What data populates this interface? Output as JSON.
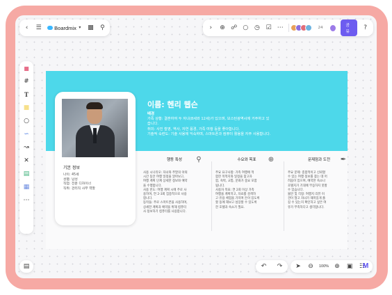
{
  "app": {
    "name": "Boardmix",
    "share_label": "공유",
    "avatar_count": "24",
    "zoom": "100%"
  },
  "toolbar_icons_top_left": [
    "back-icon",
    "menu-icon",
    "cloud-logo-icon",
    "chevron-down-icon",
    "present-icon",
    "search-icon"
  ],
  "toolbar_icons_top_right": [
    "chevron-right-icon",
    "add-icon",
    "ai-icon",
    "comment-icon",
    "timer-icon",
    "vote-icon",
    "more-icon"
  ],
  "sidebar_tools": [
    "sticky-multi-icon",
    "frame-icon",
    "text-icon",
    "sticky-note-icon",
    "shape-icon",
    "pen-icon",
    "connector-icon",
    "mindmap-icon",
    "table-icon",
    "template-icon",
    "more-tools-icon"
  ],
  "profile": {
    "name_title": "이름: 헨리 웹슨",
    "background_label": "배경",
    "background_lines": [
      "가족 상황: 결혼하여 두 자녀(8세와 12세)가 있으며, 보스턴광역시에 거주하고 있",
      "습니다.",
      "취미: 사진 촬영, 역사, 자연 풍경, 가족 여행 등을 좋아합니다.",
      "기술적 숙련도: 기술 사용에 익숙하며, 스마트폰과 컴퓨터 활용을 자주 사용합니다."
    ],
    "basic_title": "기본 정보",
    "basic_items": [
      "나이: 45세",
      "성별: 남성",
      "직업: 전문 디자이너",
      "직위: 관리직 사무 역할"
    ]
  },
  "columns": [
    {
      "title": "행동 특성",
      "icon": "search-person-icon",
      "lines": [
        "사용 시나리오: 자녀와 주말의 야외",
        "시간 동안 여행 일정을 알아보고,",
        "여행 계획 단계 상세한 정보와 예약",
        "을 수행합니다.",
        "사용 빈도: 여행 계획 시에 주로 사",
        "용하며, 연 2-3회 집중적으로 사용",
        "합니다.",
        "동작들: 주로 스마트폰을 사용하며,",
        "상세한 계획과 예약을 위해 컴퓨터",
        "사 정보하기 컴퓨터를 사용합니다."
      ]
    },
    {
      "title": "수요와 목표",
      "icon": "target-icon",
      "lines": [
        "주요 요구사항: 가족 여행에 적",
        "합한 목적지와 일정을 찾고자",
        "함, 숙박, 교통, 문화가 중요 포함",
        "됩니다.",
        "사용자 목표: 연 2회 이상 가족",
        "여행을 계획하고, 자료를 검색하",
        "고 유용 체험을 가지며 돈이 있도록",
        "할 동에 해보고 성장할 수 있도록",
        "한 호텔과 숙소가 필요."
      ]
    },
    {
      "title": "문제점과 도전",
      "icon": "tools-icon",
      "lines": [
        "주요 문제: 종합적이고 신뢰할",
        "수 있는 여행 정보를 찾는 데 어",
        "려움이 있으며, 예약한 숙소나",
        "호텔지가 기대에 부응하지 못할",
        "수 있습니다.",
        "불만 및 걱정: 여행지 리뷰 이",
        "견이 많고 자녀가 재미있게 즐",
        "길 수 있는지 확인하고 싶은 여",
        "유가 부족하다고 생각합니다."
      ]
    }
  ],
  "bottom_icons": [
    "minimap-icon",
    "undo-icon",
    "redo-icon",
    "select-icon",
    "zoom-out-icon",
    "zoom-in-icon",
    "fit-icon",
    "book-icon",
    "ai-logo-icon"
  ]
}
